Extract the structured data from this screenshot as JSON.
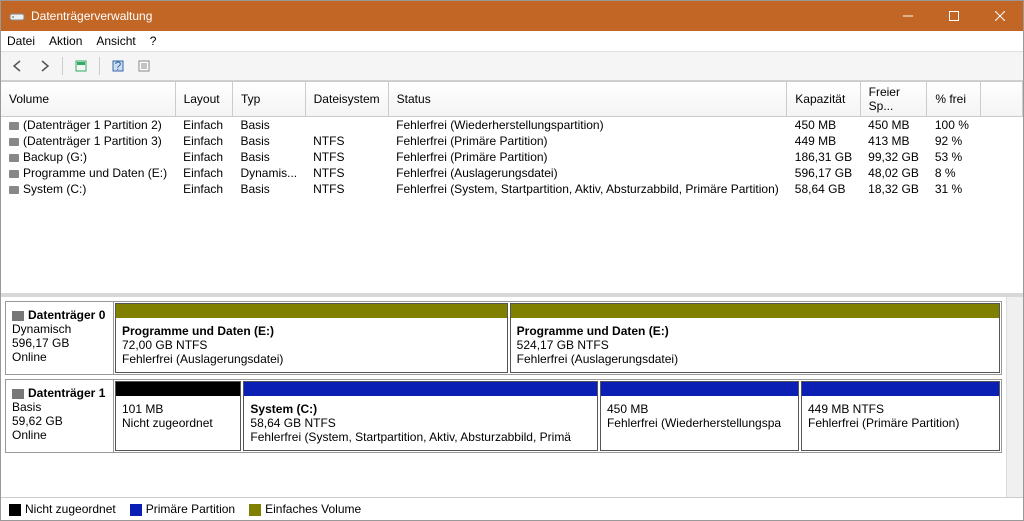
{
  "title": "Datenträgerverwaltung",
  "menu": {
    "file": "Datei",
    "action": "Aktion",
    "view": "Ansicht",
    "help": "?"
  },
  "columns": {
    "volume": "Volume",
    "layout": "Layout",
    "type": "Typ",
    "fs": "Dateisystem",
    "status": "Status",
    "capacity": "Kapazität",
    "free": "Freier Sp...",
    "pct": "% frei"
  },
  "volumes": [
    {
      "name": "(Datenträger 1 Partition 2)",
      "layout": "Einfach",
      "type": "Basis",
      "fs": "",
      "status": "Fehlerfrei (Wiederherstellungspartition)",
      "cap": "450 MB",
      "free": "450 MB",
      "pct": "100 %"
    },
    {
      "name": "(Datenträger 1 Partition 3)",
      "layout": "Einfach",
      "type": "Basis",
      "fs": "NTFS",
      "status": "Fehlerfrei (Primäre Partition)",
      "cap": "449 MB",
      "free": "413 MB",
      "pct": "92 %"
    },
    {
      "name": "Backup (G:)",
      "layout": "Einfach",
      "type": "Basis",
      "fs": "NTFS",
      "status": "Fehlerfrei (Primäre Partition)",
      "cap": "186,31 GB",
      "free": "99,32 GB",
      "pct": "53 %"
    },
    {
      "name": "Programme und Daten (E:)",
      "layout": "Einfach",
      "type": "Dynamis...",
      "fs": "NTFS",
      "status": "Fehlerfrei (Auslagerungsdatei)",
      "cap": "596,17 GB",
      "free": "48,02 GB",
      "pct": "8 %"
    },
    {
      "name": "System (C:)",
      "layout": "Einfach",
      "type": "Basis",
      "fs": "NTFS",
      "status": "Fehlerfrei (System, Startpartition, Aktiv, Absturzabbild, Primäre Partition)",
      "cap": "58,64 GB",
      "free": "18,32 GB",
      "pct": "31 %"
    }
  ],
  "disks": [
    {
      "name": "Datenträger 0",
      "type": "Dynamisch",
      "size": "596,17 GB",
      "state": "Online",
      "parts": [
        {
          "title": "Programme und Daten  (E:)",
          "sub": "72,00 GB NTFS",
          "status": "Fehlerfrei (Auslagerungsdatei)",
          "color": "simple",
          "flex": 40
        },
        {
          "title": "Programme und Daten  (E:)",
          "sub": "524,17 GB NTFS",
          "status": "Fehlerfrei (Auslagerungsdatei)",
          "color": "simple",
          "flex": 50
        }
      ]
    },
    {
      "name": "Datenträger 1",
      "type": "Basis",
      "size": "59,62 GB",
      "state": "Online",
      "parts": [
        {
          "title": "",
          "sub": "101 MB",
          "status": "Nicht zugeordnet",
          "color": "unalloc",
          "flex": 12
        },
        {
          "title": "System  (C:)",
          "sub": "58,64 GB NTFS",
          "status": "Fehlerfrei (System, Startpartition, Aktiv, Absturzabbild, Primä",
          "color": "primary",
          "flex": 34
        },
        {
          "title": "",
          "sub": "450 MB",
          "status": "Fehlerfrei (Wiederherstellungspa",
          "color": "primary",
          "flex": 19
        },
        {
          "title": "",
          "sub": "449 MB NTFS",
          "status": "Fehlerfrei (Primäre Partition)",
          "color": "primary",
          "flex": 19
        }
      ]
    }
  ],
  "legend": {
    "unalloc": "Nicht zugeordnet",
    "primary": "Primäre Partition",
    "simple": "Einfaches Volume"
  }
}
